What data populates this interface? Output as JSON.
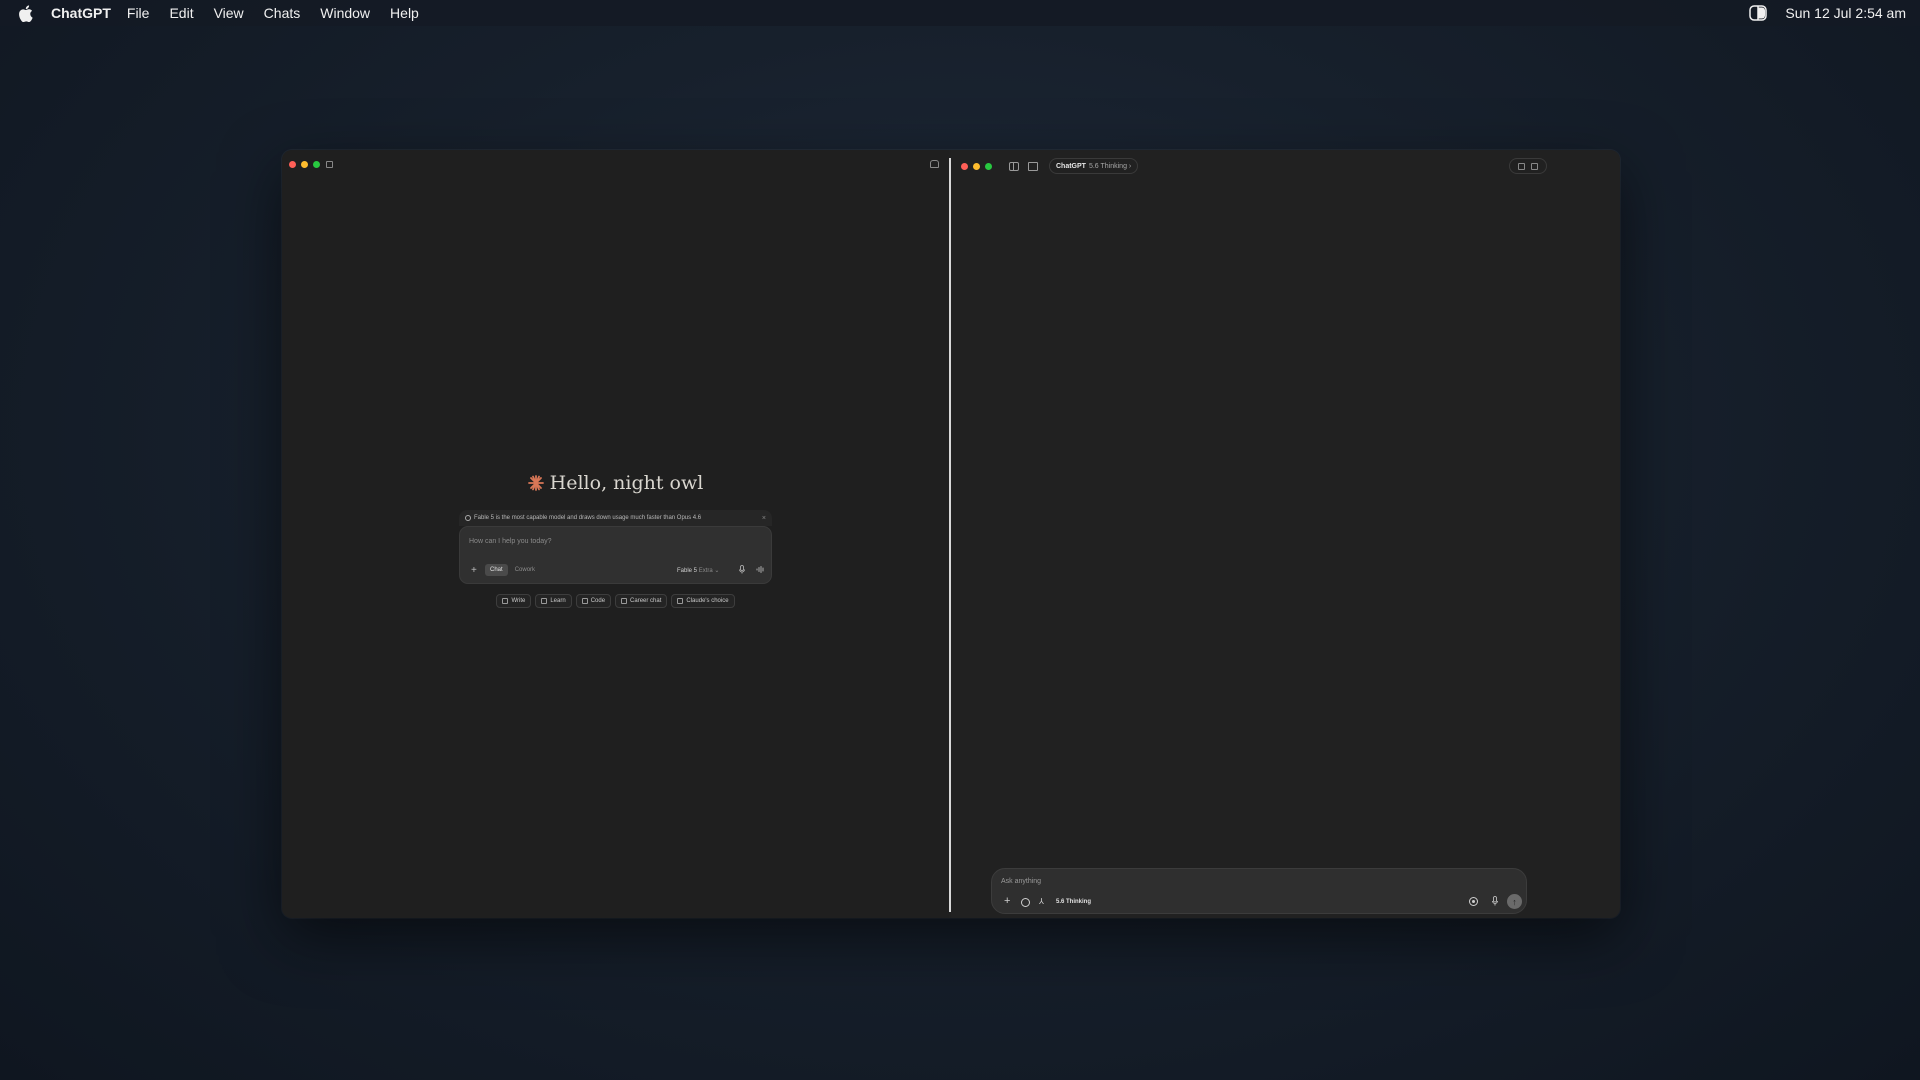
{
  "menubar": {
    "app_name": "ChatGPT",
    "menus": [
      "File",
      "Edit",
      "View",
      "Chats",
      "Window",
      "Help"
    ],
    "clock": "Sun 12 Jul  2:54 am"
  },
  "left_pane": {
    "greeting": "Hello, night owl",
    "notice": "Fable 5 is the most capable model and draws down usage much faster than Opus 4.6",
    "notice_close": "×",
    "composer": {
      "placeholder": "How can I help you today?",
      "plus": "+",
      "mode_active": "Chat",
      "mode_other": "Cowork",
      "model_name": "Fable 5",
      "model_variant": "Extra ⌄"
    },
    "chips": [
      "Write",
      "Learn",
      "Code",
      "Career chat",
      "Claude's choice"
    ]
  },
  "right_pane": {
    "model_pill": {
      "brand": "ChatGPT",
      "version": "5.6 Thinking ›"
    },
    "composer": {
      "placeholder": "Ask anything",
      "plus": "+",
      "tool_glyph": "⅄",
      "mode": "5.6 Thinking",
      "send": "↑"
    }
  },
  "colors": {
    "accent_spark": "#d97757",
    "traffic_red": "#ff5f57",
    "traffic_yellow": "#febc2e",
    "traffic_green": "#28c840"
  }
}
